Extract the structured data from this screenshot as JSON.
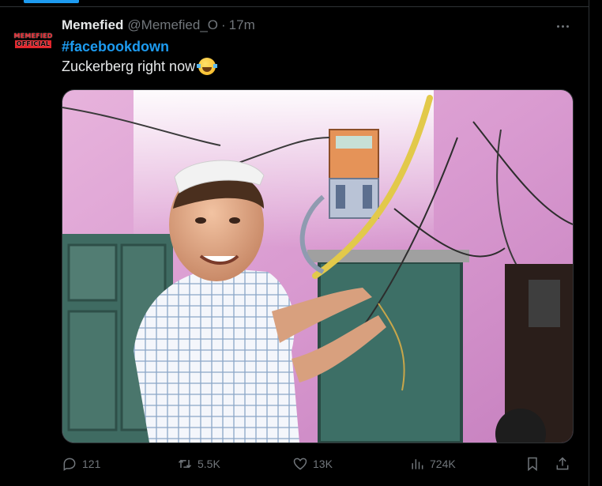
{
  "tweet": {
    "avatar_text": [
      "MEMEFIED",
      "OFFICIAL"
    ],
    "author_name": "Memefied",
    "handle": "@Memefied_O",
    "separator": "·",
    "time": "17m",
    "hashtag": "#facebookdown",
    "text": "Zuckerberg right now",
    "emoji_icon": "face-with-tears-of-joy-icon",
    "media_description_icon": "photo"
  },
  "actions": {
    "reply_count": "121",
    "retweet_count": "5.5K",
    "like_count": "13K",
    "view_count": "724K"
  },
  "colors": {
    "background": "#000000",
    "accent": "#1d9bf0",
    "muted": "#71767b",
    "text": "#e7e9ea",
    "divider": "#2f3336"
  }
}
